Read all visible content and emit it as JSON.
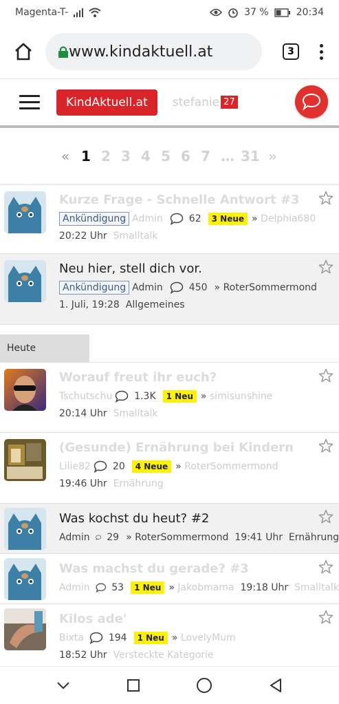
{
  "status": {
    "carrier": "Magenta-T-",
    "battery": "37 %",
    "time": "20:34"
  },
  "browser": {
    "url": "www.kindaktuell.at",
    "tab_count": "3"
  },
  "header": {
    "brand": "KindAktuell.at",
    "username": "stefanie",
    "notification_count": "27"
  },
  "pagination": {
    "prev": "«",
    "pages": [
      "1",
      "2",
      "3",
      "4",
      "5",
      "6",
      "7",
      "…",
      "31"
    ],
    "next": "»"
  },
  "day_label": "Heute",
  "threads": [
    {
      "title": "Kurze Frage - Schnelle Antwort #3",
      "tag": "Ankündigung",
      "author": "Admin",
      "replies": "62",
      "new": "3 Neue",
      "last_user": "Delphia680",
      "time": "20:22 Uhr",
      "category": "Smalltalk"
    },
    {
      "title": "Neu hier, stell dich vor.",
      "tag": "Ankündigung",
      "author": "Admin",
      "replies": "450",
      "last_user": "RoterSommermond",
      "time": "1. Juli, 19:28",
      "category": "Allgemeines"
    },
    {
      "title": "Worauf freut ihr euch?",
      "author": "Tschutschu",
      "replies": "1.3K",
      "new": "1 Neu",
      "last_user": "simisunshine",
      "time": "20:14 Uhr",
      "category": "Smalltalk"
    },
    {
      "title": "(Gesunde) Ernährung bei Kindern",
      "author": "Lilie82",
      "replies": "20",
      "new": "4 Neue",
      "last_user": "RoterSommermond",
      "time": "19:46 Uhr",
      "category": "Ernährung"
    },
    {
      "title": "Was kochst du heut? #2",
      "author": "Admin",
      "replies": "29",
      "last_user": "RoterSommermond",
      "time": "19:41 Uhr",
      "category": "Ernährung"
    },
    {
      "title": "Was machst du gerade? #3",
      "author": "Admin",
      "replies": "53",
      "new": "1 Neu",
      "last_user": "Jakobmama",
      "time": "19:18 Uhr",
      "category": "Smalltalk"
    },
    {
      "title": "Kilos ade'",
      "author": "Bixta",
      "replies": "194",
      "new": "1 Neu",
      "last_user": "LovelyMum",
      "time": "18:52 Uhr",
      "category": "Versteckte Kategorie"
    }
  ],
  "colors": {
    "brand_red": "#d9252a",
    "new_badge": "#fff200",
    "tag_border": "#7a93b8"
  }
}
